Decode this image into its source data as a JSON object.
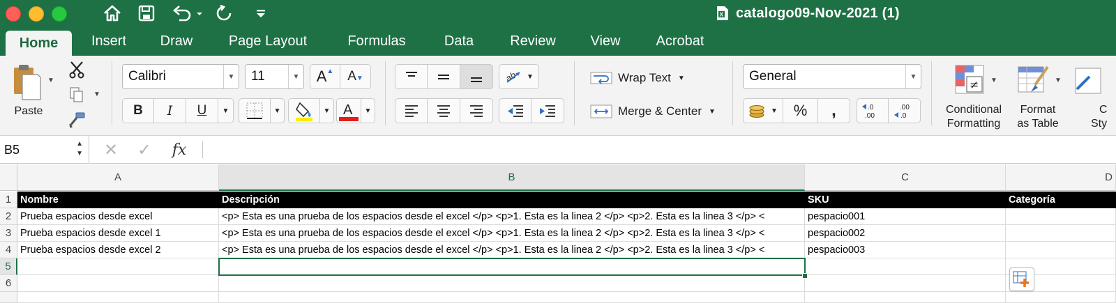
{
  "window": {
    "title": "catalogo09-Nov-2021 (1)",
    "theme_color": "#1e7145"
  },
  "quick_access": {
    "icons": [
      "home-icon",
      "save-icon",
      "undo-icon",
      "redo-icon",
      "customize-icon"
    ]
  },
  "tabs": [
    {
      "label": "Home",
      "active": true
    },
    {
      "label": "Insert"
    },
    {
      "label": "Draw"
    },
    {
      "label": "Page Layout"
    },
    {
      "label": "Formulas"
    },
    {
      "label": "Data"
    },
    {
      "label": "Review"
    },
    {
      "label": "View"
    },
    {
      "label": "Acrobat"
    }
  ],
  "ribbon": {
    "paste_label": "Paste",
    "font_name": "Calibri",
    "font_size": "11",
    "bold": "B",
    "italic": "I",
    "underline": "U",
    "wrap_text": "Wrap Text",
    "merge_center": "Merge & Center",
    "number_format": "General",
    "percent": "%",
    "comma": ",",
    "conditional_formatting": [
      "Conditional",
      "Formatting"
    ],
    "format_as_table": [
      "Format",
      "as Table"
    ],
    "cell_styles": [
      "C",
      "Sty"
    ],
    "fill_color": "#ffee00",
    "font_color": "#e0201c"
  },
  "formula_bar": {
    "name_box": "B5",
    "fx": "fx",
    "value": ""
  },
  "sheet": {
    "columns": [
      {
        "letter": "A"
      },
      {
        "letter": "B",
        "selected": true
      },
      {
        "letter": "C"
      },
      {
        "letter": "D"
      }
    ],
    "row_numbers": [
      "1",
      "2",
      "3",
      "4",
      "5",
      "6"
    ],
    "selected_row": "5",
    "rows": [
      {
        "A": "Nombre",
        "B": "Descripción",
        "C": "SKU",
        "D": "Categoría"
      },
      {
        "A": "Prueba espacios desde excel",
        "B": "<p> Esta es una prueba de los espacios desde el excel </p> <p>1. Esta es la linea 2 </p> <p>2. Esta es la linea 3 </p> <",
        "C": "pespacio001",
        "D": ""
      },
      {
        "A": "Prueba espacios desde excel 1",
        "B": "<p> Esta es una prueba de los espacios desde el excel </p> <p>1. Esta es la linea 2 </p> <p>2. Esta es la linea 3 </p> <",
        "C": "pespacio002",
        "D": ""
      },
      {
        "A": "Prueba espacios desde excel 2",
        "B": "<p> Esta es una prueba de los espacios desde el excel </p> <p>1. Esta es la linea 2 </p> <p>2. Esta es la linea 3 </p> <",
        "C": "pespacio003",
        "D": ""
      },
      {
        "A": "",
        "B": "",
        "C": "",
        "D": ""
      },
      {
        "A": "",
        "B": "",
        "C": "",
        "D": ""
      }
    ]
  }
}
